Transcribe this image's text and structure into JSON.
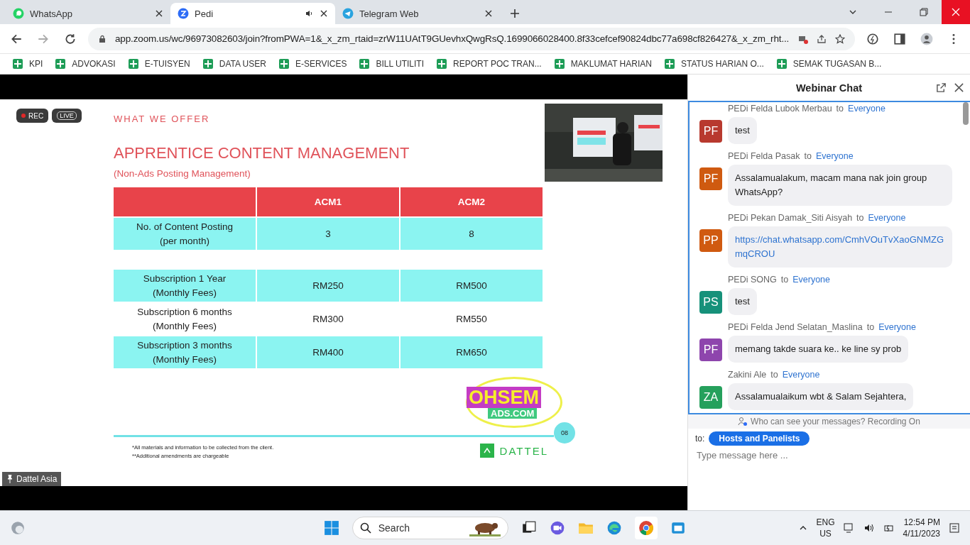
{
  "browser": {
    "tabs": [
      {
        "title": "WhatsApp",
        "selected": false,
        "audio": false
      },
      {
        "title": "Pedi",
        "selected": true,
        "audio": true
      },
      {
        "title": "Telegram Web",
        "selected": false,
        "audio": false
      }
    ],
    "url": "app.zoom.us/wc/96973082603/join?fromPWA=1&_x_zm_rtaid=zrW11UAtT9GUevhxQwgRsQ.1699066028400.8f33cefcef90824dbc77a698cf826427&_x_zm_rht...",
    "bookmarks": [
      "KPI",
      "ADVOKASI",
      "E-TUISYEN",
      "DATA USER",
      "E-SERVICES",
      "BILL UTILITI",
      "REPORT POC TRAN...",
      "MAKLUMAT HARIAN",
      "STATUS HARIAN O...",
      "SEMAK TUGASAN B..."
    ]
  },
  "meeting": {
    "rec": "REC",
    "live": "LIVE",
    "speaker": "Dattel Asia",
    "slide": {
      "eyebrow": "WHAT WE OFFER",
      "title": "APPRENTICE CONTENT MANAGEMENT",
      "subtitle": "(Non-Ads Posting Management)",
      "header": [
        "ACM1",
        "ACM2"
      ],
      "row_groups": [
        {
          "rows": [
            {
              "cells": [
                "No. of Content Posting\n(per month)",
                "3",
                "8"
              ],
              "shaded": true
            }
          ]
        },
        {
          "rows": [
            {
              "cells": [
                "Subscription 1 Year\n(Monthly Fees)",
                "RM250",
                "RM500"
              ],
              "shaded": true
            },
            {
              "cells": [
                "Subscription 6 months\n(Monthly Fees)",
                "RM300",
                "RM550"
              ],
              "shaded": false
            },
            {
              "cells": [
                "Subscription 3 months\n(Monthly Fees)",
                "RM400",
                "RM650"
              ],
              "shaded": true
            }
          ]
        }
      ],
      "logo_top": "OHSEM",
      "logo_bottom": "ADS.COM",
      "page": "08",
      "footnotes": [
        "*All materials and information to be collected from the client.",
        "**Additional amendments are chargeable"
      ],
      "brand": "DATTEL"
    }
  },
  "chat": {
    "title": "Webinar Chat",
    "messages": [
      {
        "initials": "PF",
        "color": "#b8392e",
        "sender": "PEDi Felda Lubok Merbau",
        "to": "to",
        "recipient": "Everyone",
        "text": "test",
        "kind": "text"
      },
      {
        "initials": "PF",
        "color": "#cf5a10",
        "sender": "PEDi Felda Pasak",
        "to": "to",
        "recipient": "Everyone",
        "text": "Assalamualakum, macam mana nak join group WhatsApp?",
        "kind": "text"
      },
      {
        "initials": "PP",
        "color": "#d05a10",
        "sender": "PEDi Pekan Damak_Siti Aisyah",
        "to": "to",
        "recipient": "Everyone",
        "text": "https://chat.whatsapp.com/CmhVOuTvXaoGNMZGmqCROU",
        "kind": "link"
      },
      {
        "initials": "PS",
        "color": "#16917a",
        "sender": "PEDi SONG",
        "to": "to",
        "recipient": "Everyone",
        "text": "test",
        "kind": "text"
      },
      {
        "initials": "PF",
        "color": "#8e45ad",
        "sender": "PEDi Felda Jend Selatan_Maslina",
        "to": "to",
        "recipient": "Everyone",
        "text": "memang takde suara ke.. ke line sy prob",
        "kind": "text"
      },
      {
        "initials": "ZA",
        "color": "#25a05c",
        "sender": "Zakini Ale",
        "to": "to",
        "recipient": "Everyone",
        "text": "Assalamualaikum wbt & Salam Sejahtera,",
        "kind": "text"
      }
    ],
    "privacy": "Who can see your messages? Recording On",
    "to_label": "to:",
    "recipient": "Hosts and Panelists",
    "placeholder": "Type message here ..."
  },
  "taskbar": {
    "search": "Search",
    "lang": "ENG",
    "region": "US",
    "time": "12:54 PM",
    "date": "4/11/2023"
  }
}
